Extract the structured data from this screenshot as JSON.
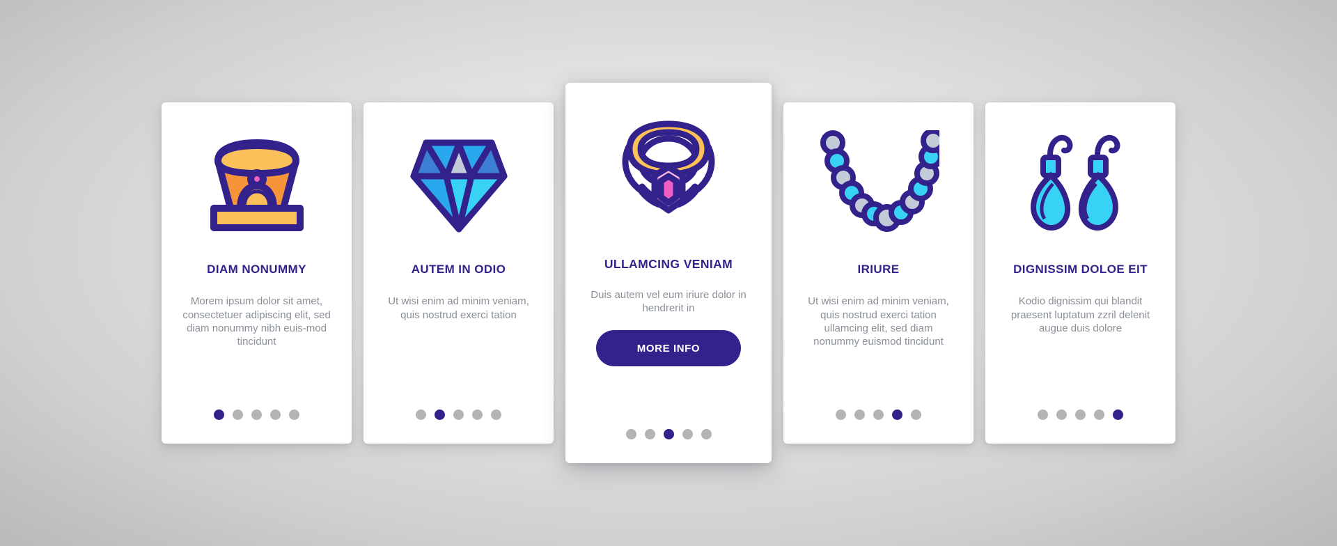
{
  "theme": {
    "accent": "#33218c",
    "body_text": "#8a9099",
    "dot_inactive": "#b4b4b4",
    "card_bg": "#ffffff",
    "page_bg": "#d4d4d4"
  },
  "cards": [
    {
      "icon": "ring-in-jewelry-box-icon",
      "title": "DIAM NONUMMY",
      "description": "Morem ipsum dolor sit amet, consectetuer adipiscing elit, sed diam nonummy nibh euis-mod tincidunt",
      "dots": {
        "count": 5,
        "active_index": 0
      },
      "featured": false,
      "button": null
    },
    {
      "icon": "diamond-gem-icon",
      "title": "AUTEM IN ODIO",
      "description": "Ut wisi enim ad minim veniam, quis nostrud exerci tation",
      "dots": {
        "count": 5,
        "active_index": 1
      },
      "featured": false,
      "button": null
    },
    {
      "icon": "gemstone-ring-icon",
      "title": "ULLAMCING VENIAM",
      "description": "Duis autem vel eum iriure dolor in hendrerit in",
      "dots": {
        "count": 5,
        "active_index": 2
      },
      "featured": true,
      "button": "MORE INFO"
    },
    {
      "icon": "pearl-necklace-icon",
      "title": "IRIURE",
      "description": "Ut wisi enim ad minim veniam, quis nostrud exerci tation ullamcing elit, sed diam nonummy euismod tincidunt",
      "dots": {
        "count": 5,
        "active_index": 3
      },
      "featured": false,
      "button": null
    },
    {
      "icon": "drop-earrings-icon",
      "title": "DIGNISSIM DOLOE EIT",
      "description": "Kodio dignissim qui blandit praesent luptatum zzril delenit augue duis dolore",
      "dots": {
        "count": 5,
        "active_index": 4
      },
      "featured": false,
      "button": null
    }
  ],
  "icon_colors": {
    "outline": "#33218c",
    "orange_dark": "#f6943a",
    "orange_light": "#fcc05a",
    "pink": "#ef5ec4",
    "blue_dark": "#3d7fd4",
    "blue_mid": "#2aa8ee",
    "blue_light": "#38d2f5",
    "grey_blue": "#c3cbd8",
    "yellow": "#fcc257",
    "magenta": "#ee5fc1",
    "pink_light": "#f9b8e4"
  }
}
